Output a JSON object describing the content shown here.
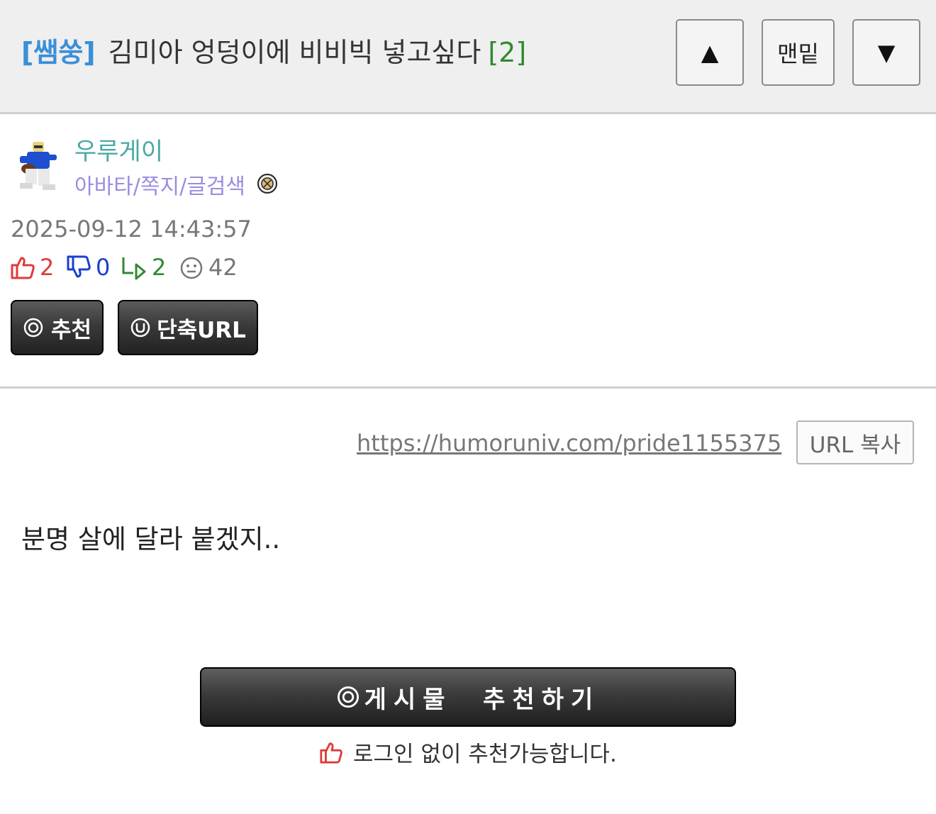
{
  "header": {
    "category": "[쌤쑹]",
    "title": "김미아 엉덩이에 비비빅 넣고싶다",
    "comment_count": "[2]",
    "nav": {
      "up": "▲",
      "bottom": "맨밑",
      "down": "▼"
    }
  },
  "author": {
    "nickname": "우루게이",
    "links": "아바타/쪽지/글검색",
    "datetime": "2025-09-12 14:43:57"
  },
  "stats": {
    "likes": "2",
    "dislikes": "0",
    "replies": "2",
    "views": "42"
  },
  "buttons": {
    "recommend": "추천",
    "short_url": "단축URL",
    "url_copy": "URL 복사"
  },
  "post": {
    "url": "https://humoruniv.com/pride1155375",
    "body": "분명 살에 달라 붙겠지.."
  },
  "bottom": {
    "recommend_post": "게시물  추천하기",
    "note": "로그인 없이 추천가능합니다."
  },
  "colors": {
    "category": "#3a8fd8",
    "comment_count": "#2f8a2f",
    "nickname": "#4aa9a3",
    "links": "#9a8de0",
    "like": "#e03a3a",
    "dislike": "#1a3fd0",
    "reply": "#2f8a2f"
  }
}
